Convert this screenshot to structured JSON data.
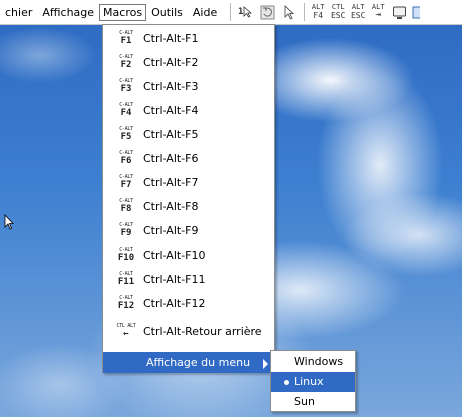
{
  "menubar": {
    "items": [
      "chier",
      "Affichage",
      "Macros",
      "Outils",
      "Aide"
    ]
  },
  "toolbar": {
    "btn1_label": "1",
    "alt_f4": [
      "ALT",
      "F4"
    ],
    "ctl_esc": [
      "CTL",
      "ESC"
    ],
    "alt_esc": [
      "ALT",
      "ESC"
    ],
    "alt_tab": [
      "ALT",
      "⇥"
    ]
  },
  "macros_menu": {
    "items": [
      {
        "icon_top": "C-ALT",
        "icon_bot": "F1",
        "label": "Ctrl-Alt-F1"
      },
      {
        "icon_top": "C-ALT",
        "icon_bot": "F2",
        "label": "Ctrl-Alt-F2"
      },
      {
        "icon_top": "C-ALT",
        "icon_bot": "F3",
        "label": "Ctrl-Alt-F3"
      },
      {
        "icon_top": "C-ALT",
        "icon_bot": "F4",
        "label": "Ctrl-Alt-F4"
      },
      {
        "icon_top": "C-ALT",
        "icon_bot": "F5",
        "label": "Ctrl-Alt-F5"
      },
      {
        "icon_top": "C-ALT",
        "icon_bot": "F6",
        "label": "Ctrl-Alt-F6"
      },
      {
        "icon_top": "C-ALT",
        "icon_bot": "F7",
        "label": "Ctrl-Alt-F7"
      },
      {
        "icon_top": "C-ALT",
        "icon_bot": "F8",
        "label": "Ctrl-Alt-F8"
      },
      {
        "icon_top": "C-ALT",
        "icon_bot": "F9",
        "label": "Ctrl-Alt-F9"
      },
      {
        "icon_top": "C-ALT",
        "icon_bot": "F10",
        "label": "Ctrl-Alt-F10"
      },
      {
        "icon_top": "C-ALT",
        "icon_bot": "F11",
        "label": "Ctrl-Alt-F11"
      },
      {
        "icon_top": "C-ALT",
        "icon_bot": "F12",
        "label": "Ctrl-Alt-F12"
      },
      {
        "icon_top": "CTL ALT",
        "icon_bot": "←",
        "label": "Ctrl-Alt-Retour arrière"
      }
    ],
    "submenu_parent_label": "Affichage du menu"
  },
  "submenu": {
    "items": [
      "Windows",
      "Linux",
      "Sun"
    ],
    "selected": "Linux"
  },
  "colors": {
    "highlight": "#316ac5"
  }
}
